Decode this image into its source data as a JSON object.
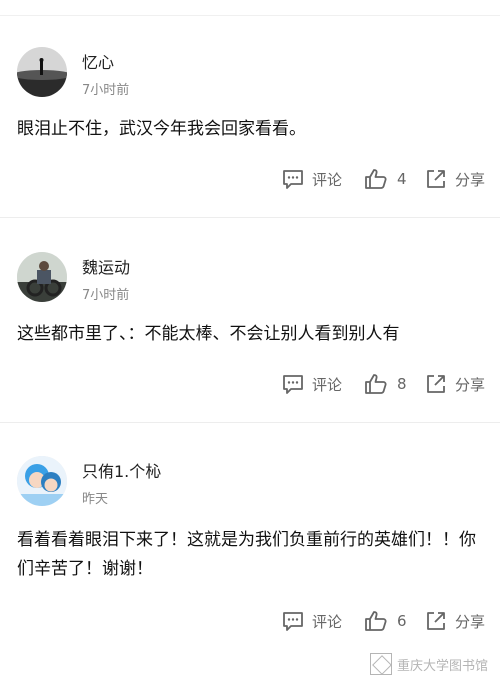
{
  "comments": [
    {
      "username": "忆心",
      "time": "7小时前",
      "text": "眼泪止不住，武汉今年我会回家看看。",
      "comment_label": "评论",
      "like_count": "4",
      "share_label": "分享"
    },
    {
      "username": "魏运动",
      "time": "7小时前",
      "text": "这些都市里了、：不能太棒、不会让别人看到别人有",
      "comment_label": "评论",
      "like_count": "8",
      "share_label": "分享"
    },
    {
      "username": "只侑1.个杺",
      "time": "昨天",
      "text": "看着看着眼泪下来了！这就是为我们负重前行的英雄们！！你们辛苦了！谢谢！",
      "comment_label": "评论",
      "like_count": "6",
      "share_label": "分享"
    }
  ],
  "watermark": "重庆大学图书馆",
  "icons": [
    "comment-icon",
    "thumbs-up-icon",
    "share-icon"
  ]
}
